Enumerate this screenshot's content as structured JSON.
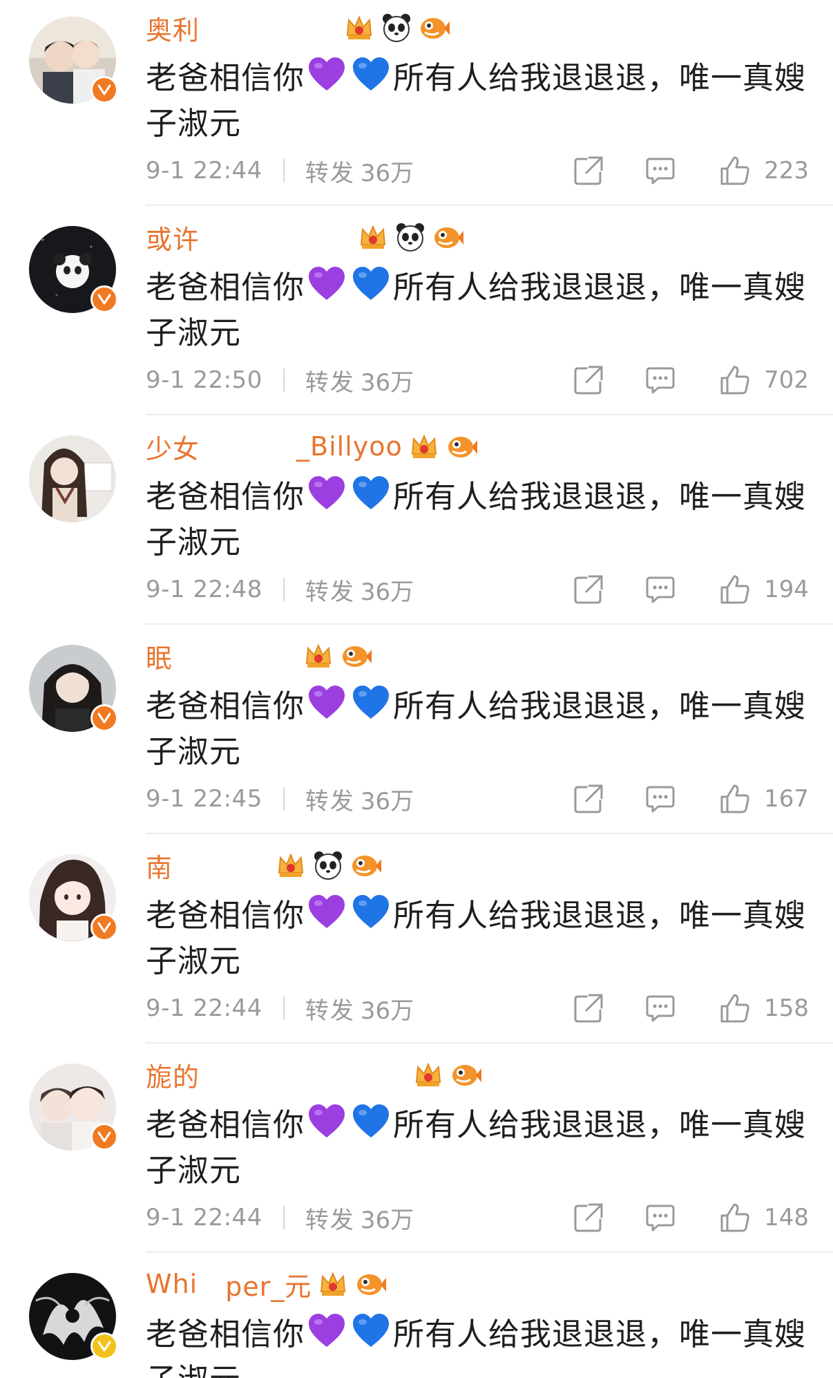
{
  "accent_color": "#e8742e",
  "comments": [
    {
      "username": "奥利",
      "emblems": [
        "crown-badge-icon",
        "panda-icon",
        "fish-icon"
      ],
      "text_main": "老爸相信你",
      "emoji": [
        "purple-heart-icon",
        "blue-heart-icon"
      ],
      "text_tail": "所有人给我退退退，唯一真嫂子淑元",
      "time": "9-1 22:44",
      "repost_label": "转发",
      "repost_count": "36万",
      "likes": "223",
      "verified_color": "#f07a22"
    },
    {
      "username": "或许",
      "emblems": [
        "crown-badge-icon",
        "panda-icon",
        "fish-icon"
      ],
      "text_main": "老爸相信你",
      "emoji": [
        "purple-heart-icon",
        "blue-heart-icon"
      ],
      "text_tail": "所有人给我退退退，唯一真嫂子淑元",
      "time": "9-1 22:50",
      "repost_label": "转发",
      "repost_count": "36万",
      "likes": "702",
      "verified_color": "#f07a22"
    },
    {
      "username": "少女",
      "username_tail": "_Billyoo",
      "emblems": [
        "crown-badge-icon",
        "fish-icon"
      ],
      "text_main": "老爸相信你",
      "emoji": [
        "purple-heart-icon",
        "blue-heart-icon"
      ],
      "text_tail": "所有人给我退退退，唯一真嫂子淑元",
      "time": "9-1 22:48",
      "repost_label": "转发",
      "repost_count": "36万",
      "likes": "194",
      "verified_color": null
    },
    {
      "username": "眠",
      "emblems": [
        "crown-badge-icon",
        "fish-icon"
      ],
      "text_main": "老爸相信你",
      "emoji": [
        "purple-heart-icon",
        "blue-heart-icon"
      ],
      "text_tail": "所有人给我退退退，唯一真嫂子淑元",
      "time": "9-1 22:45",
      "repost_label": "转发",
      "repost_count": "36万",
      "likes": "167",
      "verified_color": "#f07a22"
    },
    {
      "username": "南",
      "emblems": [
        "crown-badge-icon",
        "panda-icon",
        "fish-icon"
      ],
      "text_main": "老爸相信你",
      "emoji": [
        "purple-heart-icon",
        "blue-heart-icon"
      ],
      "text_tail": "所有人给我退退退，唯一真嫂子淑元",
      "time": "9-1 22:44",
      "repost_label": "转发",
      "repost_count": "36万",
      "likes": "158",
      "verified_color": "#f07a22"
    },
    {
      "username": "旎的",
      "emblems": [
        "crown-badge-icon",
        "fish-icon"
      ],
      "text_main": "老爸相信你",
      "emoji": [
        "purple-heart-icon",
        "blue-heart-icon"
      ],
      "text_tail": "所有人给我退退退，唯一真嫂子淑元",
      "time": "9-1 22:44",
      "repost_label": "转发",
      "repost_count": "36万",
      "likes": "148",
      "verified_color": "#f07a22"
    },
    {
      "username": "Whi",
      "username_tail": "per_元",
      "emblems": [
        "crown-badge-icon",
        "fish-icon"
      ],
      "text_main": "老爸相信你",
      "emoji": [
        "purple-heart-icon",
        "blue-heart-icon"
      ],
      "text_tail": "所有人给我退退退，唯一真嫂子淑元",
      "time": "",
      "repost_label": "",
      "repost_count": "",
      "likes": "",
      "verified_color": "#f2c21a"
    }
  ]
}
